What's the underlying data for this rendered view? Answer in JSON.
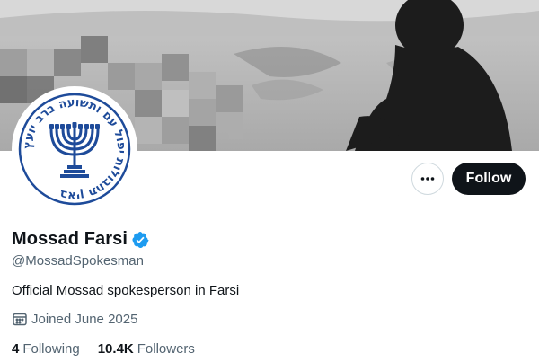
{
  "profile": {
    "display_name": "Mossad Farsi",
    "handle": "@MossadSpokesman",
    "bio": "Official Mossad spokesperson in Farsi",
    "joined": "Joined June 2025",
    "verified": true,
    "avatar_logo_text": "באין תחבולות יפול עם ותשועה ברב יועץ"
  },
  "actions": {
    "more_icon": "more-horizontal-icon",
    "follow_label": "Follow"
  },
  "stats": {
    "following_count": "4",
    "following_label": "Following",
    "followers_count": "10.4K",
    "followers_label": "Followers"
  },
  "colors": {
    "verified_blue": "#1d9bf0",
    "emblem_blue": "#1e4b9a",
    "follow_button_bg": "#0f1419",
    "secondary_text": "#536471"
  }
}
